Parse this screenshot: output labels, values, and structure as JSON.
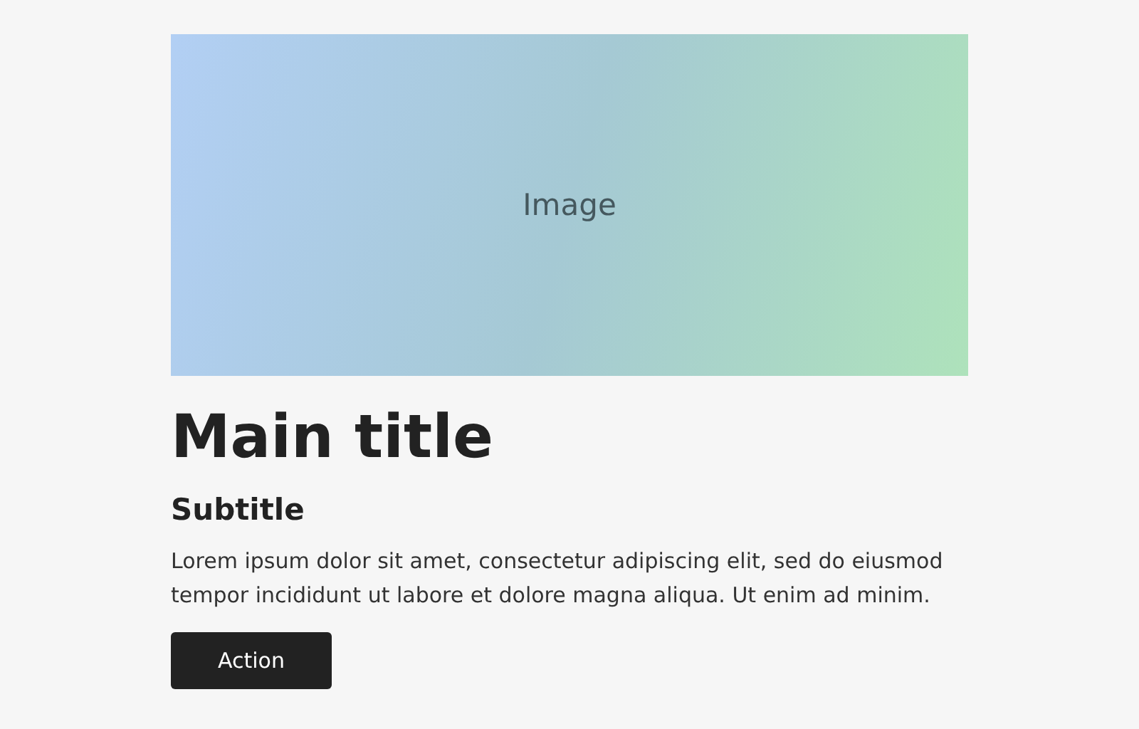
{
  "image_placeholder": {
    "label": "Image"
  },
  "title": "Main title",
  "subtitle": "Subtitle",
  "body": "Lorem ipsum dolor sit amet, consectetur adipiscing elit, sed do eiusmod tempor incididunt ut labore et dolore magna aliqua. Ut enim ad minim.",
  "button": {
    "label": "Action"
  }
}
